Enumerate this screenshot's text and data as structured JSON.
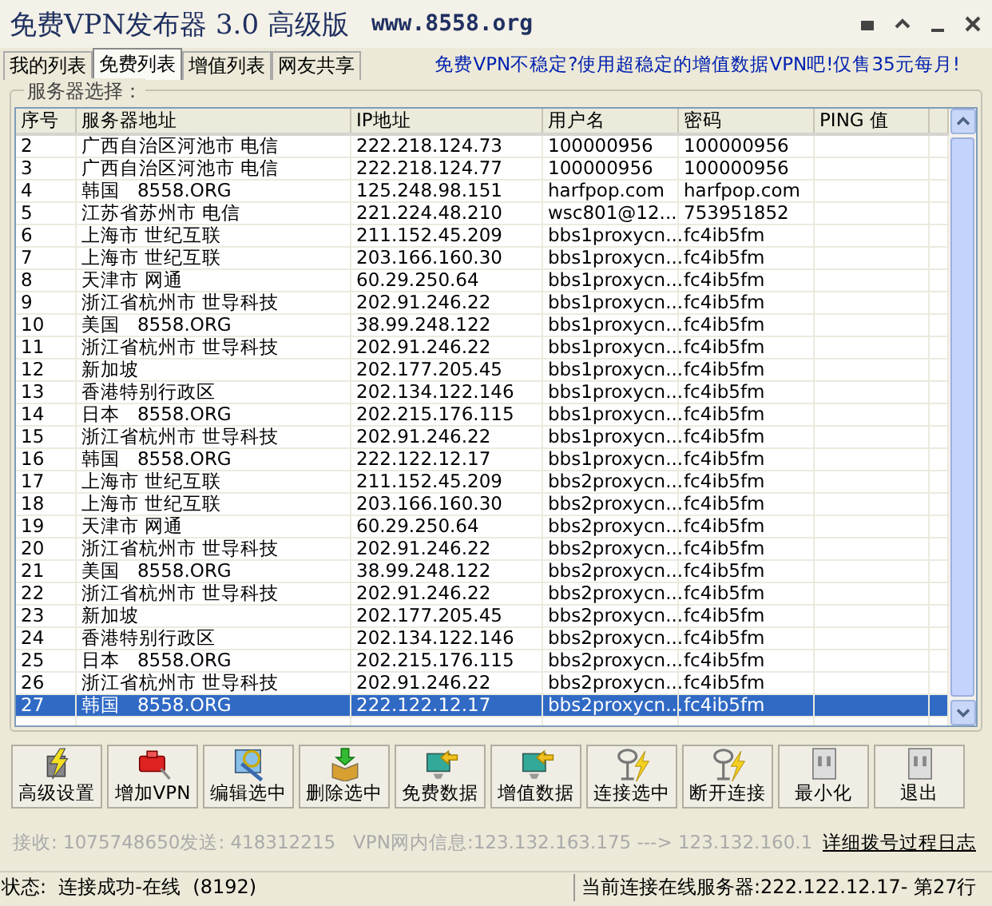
{
  "window": {
    "title": "免费VPN发布器 3.0 高级版",
    "url": "www.8558.org"
  },
  "tabs": [
    {
      "label": "我的列表",
      "selected": false
    },
    {
      "label": "免费列表",
      "selected": true
    },
    {
      "label": "增值列表",
      "selected": false
    },
    {
      "label": "网友共享",
      "selected": false
    }
  ],
  "promo": "免费VPN不稳定?使用超稳定的增值数据VPN吧!仅售35元每月!",
  "group_label": "服务器选择：",
  "table": {
    "columns": [
      "序号",
      "服务器地址",
      "IP地址",
      "用户名",
      "密码",
      "PING 值"
    ],
    "rows": [
      {
        "cells": [
          "2",
          "广西自治区河池市 电信",
          "222.218.124.73",
          "100000956",
          "100000956",
          ""
        ],
        "selected": false
      },
      {
        "cells": [
          "3",
          "广西自治区河池市 电信",
          "222.218.124.77",
          "100000956",
          "100000956",
          ""
        ],
        "selected": false
      },
      {
        "cells": [
          "4",
          "韩国   8558.ORG",
          "125.248.98.151",
          "harfpop.com",
          "harfpop.com",
          ""
        ],
        "selected": false
      },
      {
        "cells": [
          "5",
          "江苏省苏州市 电信",
          "221.224.48.210",
          "wsc801@12...",
          "753951852",
          ""
        ],
        "selected": false
      },
      {
        "cells": [
          "6",
          "上海市 世纪互联",
          "211.152.45.209",
          "bbs1proxycn...",
          "fc4ib5fm",
          ""
        ],
        "selected": false
      },
      {
        "cells": [
          "7",
          "上海市 世纪互联",
          "203.166.160.30",
          "bbs1proxycn...",
          "fc4ib5fm",
          ""
        ],
        "selected": false
      },
      {
        "cells": [
          "8",
          "天津市 网通",
          "60.29.250.64",
          "bbs1proxycn...",
          "fc4ib5fm",
          ""
        ],
        "selected": false
      },
      {
        "cells": [
          "9",
          "浙江省杭州市 世导科技",
          "202.91.246.22",
          "bbs1proxycn...",
          "fc4ib5fm",
          ""
        ],
        "selected": false
      },
      {
        "cells": [
          "10",
          "美国   8558.ORG",
          "38.99.248.122",
          "bbs1proxycn...",
          "fc4ib5fm",
          ""
        ],
        "selected": false
      },
      {
        "cells": [
          "11",
          "浙江省杭州市 世导科技",
          "202.91.246.22",
          "bbs1proxycn...",
          "fc4ib5fm",
          ""
        ],
        "selected": false
      },
      {
        "cells": [
          "12",
          "新加坡",
          "202.177.205.45",
          "bbs1proxycn...",
          "fc4ib5fm",
          ""
        ],
        "selected": false
      },
      {
        "cells": [
          "13",
          "香港特别行政区",
          "202.134.122.146",
          "bbs1proxycn...",
          "fc4ib5fm",
          ""
        ],
        "selected": false
      },
      {
        "cells": [
          "14",
          "日本   8558.ORG",
          "202.215.176.115",
          "bbs1proxycn...",
          "fc4ib5fm",
          ""
        ],
        "selected": false
      },
      {
        "cells": [
          "15",
          "浙江省杭州市 世导科技",
          "202.91.246.22",
          "bbs1proxycn...",
          "fc4ib5fm",
          ""
        ],
        "selected": false
      },
      {
        "cells": [
          "16",
          "韩国   8558.ORG",
          "222.122.12.17",
          "bbs1proxycn...",
          "fc4ib5fm",
          ""
        ],
        "selected": false
      },
      {
        "cells": [
          "17",
          "上海市 世纪互联",
          "211.152.45.209",
          "bbs2proxycn...",
          "fc4ib5fm",
          ""
        ],
        "selected": false
      },
      {
        "cells": [
          "18",
          "上海市 世纪互联",
          "203.166.160.30",
          "bbs2proxycn...",
          "fc4ib5fm",
          ""
        ],
        "selected": false
      },
      {
        "cells": [
          "19",
          "天津市 网通",
          "60.29.250.64",
          "bbs2proxycn...",
          "fc4ib5fm",
          ""
        ],
        "selected": false
      },
      {
        "cells": [
          "20",
          "浙江省杭州市 世导科技",
          "202.91.246.22",
          "bbs2proxycn...",
          "fc4ib5fm",
          ""
        ],
        "selected": false
      },
      {
        "cells": [
          "21",
          "美国   8558.ORG",
          "38.99.248.122",
          "bbs2proxycn...",
          "fc4ib5fm",
          ""
        ],
        "selected": false
      },
      {
        "cells": [
          "22",
          "浙江省杭州市 世导科技",
          "202.91.246.22",
          "bbs2proxycn...",
          "fc4ib5fm",
          ""
        ],
        "selected": false
      },
      {
        "cells": [
          "23",
          "新加坡",
          "202.177.205.45",
          "bbs2proxycn...",
          "fc4ib5fm",
          ""
        ],
        "selected": false
      },
      {
        "cells": [
          "24",
          "香港特别行政区",
          "202.134.122.146",
          "bbs2proxycn...",
          "fc4ib5fm",
          ""
        ],
        "selected": false
      },
      {
        "cells": [
          "25",
          "日本   8558.ORG",
          "202.215.176.115",
          "bbs2proxycn...",
          "fc4ib5fm",
          ""
        ],
        "selected": false
      },
      {
        "cells": [
          "26",
          "浙江省杭州市 世导科技",
          "202.91.246.22",
          "bbs2proxycn...",
          "fc4ib5fm",
          ""
        ],
        "selected": false
      },
      {
        "cells": [
          "27",
          "韩国   8558.ORG",
          "222.122.12.17",
          "bbs2proxycn...",
          "fc4ib5fm",
          ""
        ],
        "selected": true
      }
    ]
  },
  "toolbar": [
    {
      "label": "高级设置",
      "kind": "settings"
    },
    {
      "label": "增加VPN",
      "kind": "add"
    },
    {
      "label": "编辑选中",
      "kind": "edit"
    },
    {
      "label": "删除选中",
      "kind": "delete"
    },
    {
      "label": "免费数据",
      "kind": "import"
    },
    {
      "label": "增值数据",
      "kind": "import"
    },
    {
      "label": "连接选中",
      "kind": "connect"
    },
    {
      "label": "断开连接",
      "kind": "connect"
    },
    {
      "label": "最小化",
      "kind": "window"
    },
    {
      "label": "退出",
      "kind": "window"
    }
  ],
  "traffic": "接收: 1075748650发送: 418312215   VPN网内信息:123.132.163.175 ---> 123.132.160.1",
  "log_link": "详细拨号过程日志",
  "status_bar": {
    "status": "状态:  连接成功-在线  (8192)",
    "server": "当前连接在线服务器:222.122.12.17- 第27行"
  }
}
